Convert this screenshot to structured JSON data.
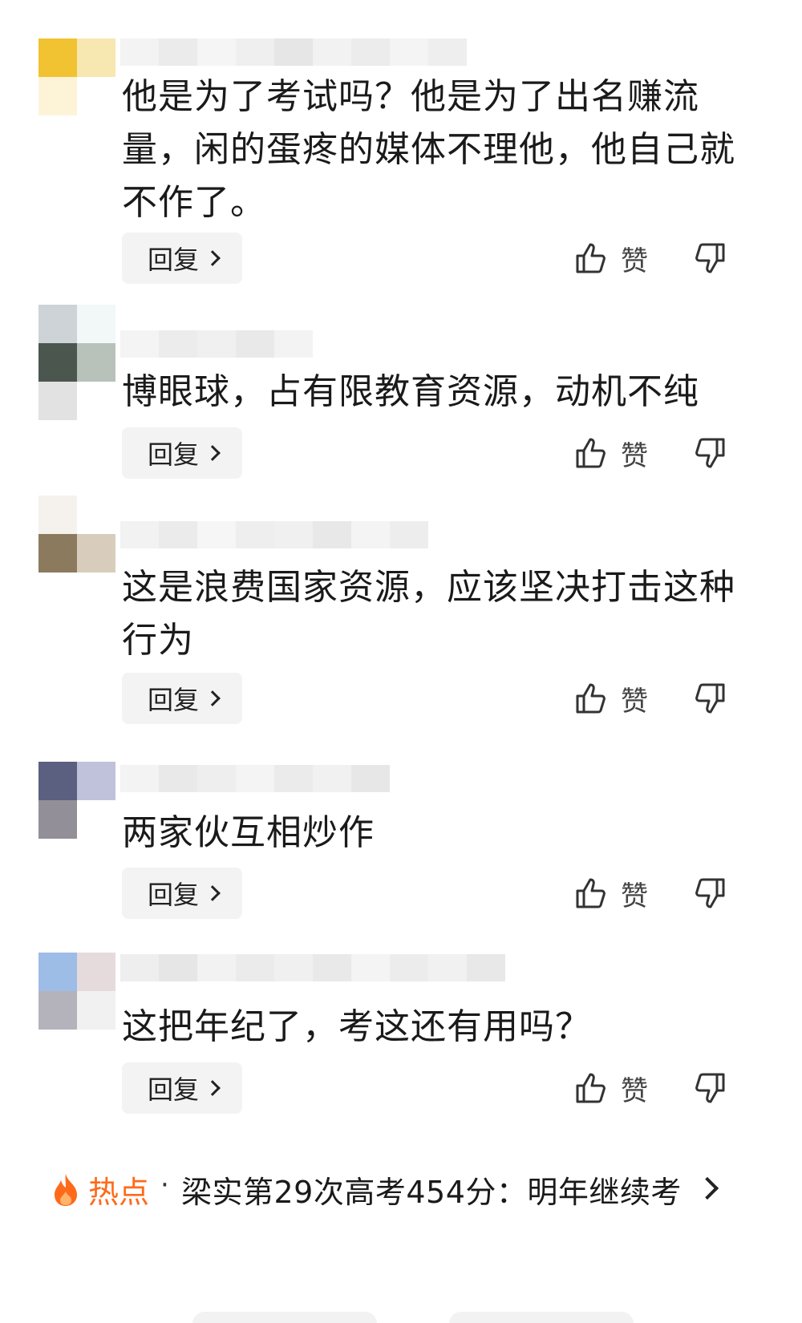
{
  "comments": [
    {
      "text": "他是为了考试吗？他是为了出名赚流量，闲的蛋疼的媒体不理他，他自己就不作了。",
      "reply_label": "回复",
      "like_label": "赞",
      "avatar_colors": [
        "#f1c232",
        "#f7e7b0",
        "#fdf4d8",
        "#ffffff"
      ]
    },
    {
      "text": "博眼球，占有限教育资源，动机不纯",
      "reply_label": "回复",
      "like_label": "赞",
      "avatar_colors": [
        "#cdd3d6",
        "#f2f7f8",
        "#4b564f",
        "#b9c1bb"
      ]
    },
    {
      "text": "这是浪费国家资源，应该坚决打击这种行为",
      "reply_label": "回复",
      "like_label": "赞",
      "avatar_colors": [
        "#f5f2ee",
        "#ffffff",
        "#8c7a5e",
        "#d8cdbd"
      ]
    },
    {
      "text": "两家伙互相炒作",
      "reply_label": "回复",
      "like_label": "赞",
      "avatar_colors": [
        "#5b5f80",
        "#c0c2dc",
        "#938f98",
        "#ffffff"
      ]
    },
    {
      "text": "这把年纪了，考这还有用吗？",
      "reply_label": "回复",
      "like_label": "赞",
      "avatar_colors": [
        "#9dbce6",
        "#e6dbdc",
        "#b4b2bb",
        "#f1f1f1"
      ]
    }
  ],
  "hot": {
    "tag": "热点",
    "separator": "·",
    "title": "梁实第29次高考454分：明年继续考"
  },
  "colors": {
    "accent": "#ff6a1a",
    "button_bg": "#f3f3f3"
  },
  "icons": {
    "like": "thumbs-up-icon",
    "dislike": "thumbs-down-icon",
    "hot": "fire-icon",
    "more": "chevron-right-icon"
  }
}
